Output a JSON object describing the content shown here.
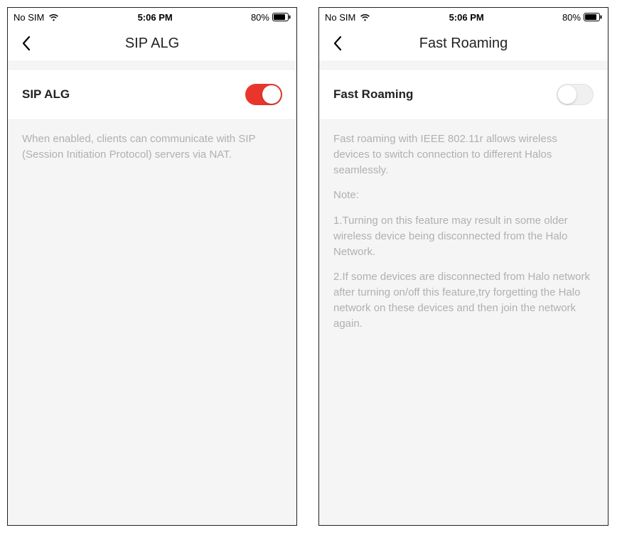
{
  "screens": [
    {
      "status": {
        "carrier": "No SIM",
        "time": "5:06 PM",
        "battery": "80%"
      },
      "title": "SIP ALG",
      "setting_label": "SIP ALG",
      "toggle_on": true,
      "descriptions": [
        "When enabled, clients can communicate with SIP (Session Initiation Protocol) servers via NAT."
      ]
    },
    {
      "status": {
        "carrier": "No SIM",
        "time": "5:06 PM",
        "battery": "80%"
      },
      "title": "Fast Roaming",
      "setting_label": "Fast Roaming",
      "toggle_on": false,
      "descriptions": [
        "Fast roaming with IEEE 802.11r allows wireless devices to switch connection to different Halos seamlessly.",
        "Note:",
        "1.Turning on this feature may result in some older wireless device being disconnected from the Halo Network.",
        "2.If some devices are disconnected from Halo network after turning on/off this feature,try forgetting the Halo network on these devices and then join the network again."
      ]
    }
  ]
}
